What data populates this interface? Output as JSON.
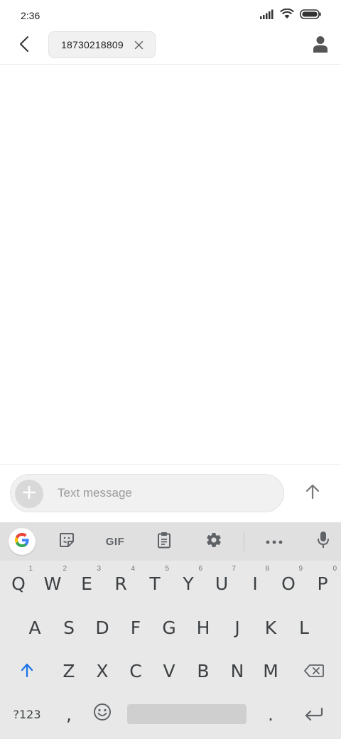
{
  "status_bar": {
    "time": "2:36",
    "icons": [
      "signal-icon",
      "wifi-icon",
      "battery-icon"
    ]
  },
  "header": {
    "back_icon": "back-arrow-icon",
    "recipient": "18730218809",
    "chip_remove_icon": "close-icon",
    "contact_icon": "person-icon"
  },
  "compose": {
    "add_icon": "plus-icon",
    "placeholder": "Text message",
    "value": "",
    "send_icon": "arrow-up-icon"
  },
  "keyboard": {
    "toolbar": {
      "items": [
        "google-icon",
        "sticker-icon",
        "GIF",
        "clipboard-icon",
        "gear-icon",
        "more-icon",
        "mic-icon"
      ],
      "gif_label": "GIF"
    },
    "rows": {
      "row1": [
        {
          "key": "Q",
          "hint": "1"
        },
        {
          "key": "W",
          "hint": "2"
        },
        {
          "key": "E",
          "hint": "3"
        },
        {
          "key": "R",
          "hint": "4"
        },
        {
          "key": "T",
          "hint": "5"
        },
        {
          "key": "Y",
          "hint": "6"
        },
        {
          "key": "U",
          "hint": "7"
        },
        {
          "key": "I",
          "hint": "8"
        },
        {
          "key": "O",
          "hint": "9"
        },
        {
          "key": "P",
          "hint": "0"
        }
      ],
      "row2": [
        "A",
        "S",
        "D",
        "F",
        "G",
        "H",
        "J",
        "K",
        "L"
      ],
      "row3": [
        "Z",
        "X",
        "C",
        "V",
        "B",
        "N",
        "M"
      ],
      "row4": {
        "symbols_label": "?123",
        "comma": ",",
        "period": "."
      }
    },
    "colors": {
      "shift_active": "#1a73e8",
      "key_text": "#3c4043",
      "keyboard_bg": "#e8e8e8",
      "toolbar_bg": "#e0e0e0"
    }
  }
}
